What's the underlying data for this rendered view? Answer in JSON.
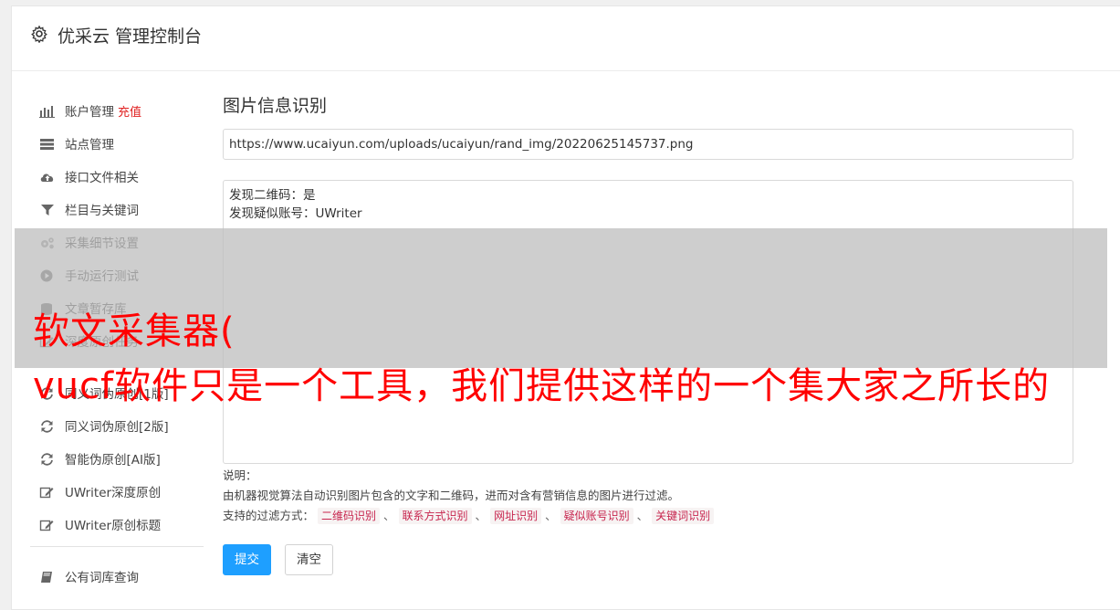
{
  "header": {
    "title": "优采云 管理控制台"
  },
  "sidebar": {
    "items": [
      {
        "label": "账户管理",
        "tag": "充值",
        "icon": "bar-chart-icon"
      },
      {
        "label": "站点管理",
        "icon": "server-icon"
      },
      {
        "label": "接口文件相关",
        "icon": "cloud-upload-icon"
      },
      {
        "label": "栏目与关键词",
        "icon": "filter-icon"
      },
      {
        "label": "采集细节设置",
        "icon": "gears-icon"
      },
      {
        "label": "手动运行测试",
        "icon": "play-circle-icon"
      },
      {
        "label": "文章暂存库",
        "icon": "database-icon"
      },
      {
        "label": "深度原创任务",
        "icon": "edit-icon"
      },
      {
        "label": "同义词伪原创[1版]",
        "icon": "refresh-icon"
      },
      {
        "label": "同义词伪原创[2版]",
        "icon": "refresh-icon"
      },
      {
        "label": "智能伪原创[AI版]",
        "icon": "refresh-icon"
      },
      {
        "label": "UWriter深度原创",
        "icon": "edit-icon"
      },
      {
        "label": "UWriter原创标题",
        "icon": "edit-icon"
      },
      {
        "label": "公有词库查询",
        "icon": "book-icon"
      }
    ]
  },
  "main": {
    "title": "图片信息识别",
    "url_value": "https://www.ucaiyun.com/uploads/ucaiyun/rand_img/20220625145737.png",
    "result_lines": [
      "发现二维码：是",
      "发现疑似账号：UWriter"
    ],
    "notes_label": "说明：",
    "notes_desc": "由机器视觉算法自动识别图片包含的文字和二维码，进而对含有营销信息的图片进行过滤。",
    "filter_label": "支持的过滤方式：",
    "filters": [
      "二维码识别",
      "联系方式识别",
      "网址识别",
      "疑似账号识别",
      "关键词识别"
    ],
    "filter_separator": "、",
    "submit_label": "提交",
    "clear_label": "清空"
  },
  "overlay": {
    "line1": "软文采集器(",
    "line2": "vucf软件只是一个工具，我们提供这样的一个集大家之所长的"
  },
  "colors": {
    "accent": "#1e9fff",
    "tag_red": "#e02020",
    "overlay_text": "#ff0000",
    "chip_text": "#c7254e"
  }
}
